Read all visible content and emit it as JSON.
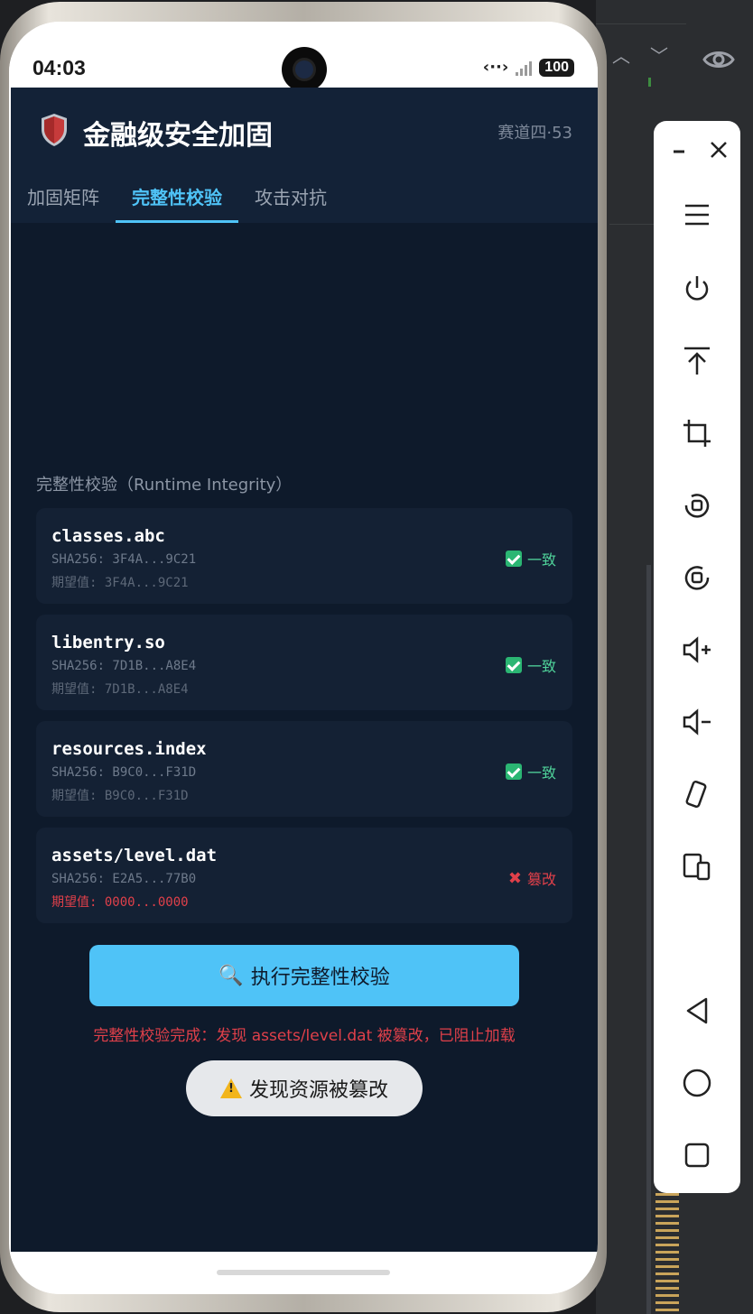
{
  "status_bar": {
    "time": "04:03",
    "battery": "100"
  },
  "app": {
    "title": "金融级安全加固",
    "meta": "赛道四·53",
    "tabs": [
      {
        "label": "加固矩阵",
        "active": false
      },
      {
        "label": "完整性校验",
        "active": true
      },
      {
        "label": "攻击对抗",
        "active": false
      }
    ],
    "section_title": "完整性校验（Runtime Integrity）",
    "files": [
      {
        "name": "classes.abc",
        "hash": "SHA256: 3F4A...9C21",
        "expected": "期望值: 3F4A...9C21",
        "status": "一致",
        "ok": true
      },
      {
        "name": "libentry.so",
        "hash": "SHA256: 7D1B...A8E4",
        "expected": "期望值: 7D1B...A8E4",
        "status": "一致",
        "ok": true
      },
      {
        "name": "resources.index",
        "hash": "SHA256: B9C0...F31D",
        "expected": "期望值: B9C0...F31D",
        "status": "一致",
        "ok": true
      },
      {
        "name": "assets/level.dat",
        "hash": "SHA256: E2A5...77B0",
        "expected": "期望值: 0000...0000",
        "status": "篡改",
        "ok": false
      }
    ],
    "run_button_label": "执行完整性校验",
    "result_text": "完整性校验完成：发现 assets/level.dat 被篡改，已阻止加载",
    "toast_text": "发现资源被篡改"
  },
  "colors": {
    "accent": "#4fc3f7",
    "ok": "#4fd39a",
    "bad": "#e0404a",
    "background": "#0e1a2b"
  },
  "emulator_toolbar": {
    "buttons": [
      "minimize-icon",
      "close-icon",
      "menu-icon",
      "power-icon",
      "upload-icon",
      "crop-icon",
      "rotate-left-icon",
      "rotate-right-icon",
      "volume-up-icon",
      "volume-down-icon",
      "shake-icon",
      "multi-device-icon",
      "back-icon",
      "home-icon",
      "overview-icon"
    ]
  }
}
